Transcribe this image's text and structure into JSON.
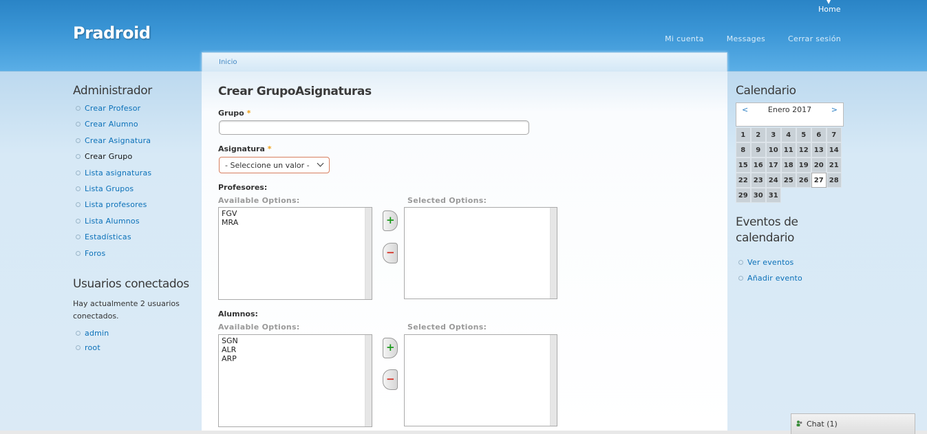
{
  "header": {
    "site_name": "Pradroid",
    "home": "Home",
    "secondary_nav": [
      "Mi cuenta",
      "Messages",
      "Cerrar sesión"
    ]
  },
  "breadcrumb": "Inicio",
  "sidebar_left": {
    "admin_title": "Administrador",
    "admin_menu": [
      {
        "label": "Crear Profesor",
        "active": false
      },
      {
        "label": "Crear Alumno",
        "active": false
      },
      {
        "label": "Crear Asignatura",
        "active": false
      },
      {
        "label": "Crear Grupo",
        "active": true
      },
      {
        "label": "Lista asignaturas",
        "active": false
      },
      {
        "label": "Lista Grupos",
        "active": false
      },
      {
        "label": "Lista profesores",
        "active": false
      },
      {
        "label": "Lista Alumnos",
        "active": false
      },
      {
        "label": "Estadísticas",
        "active": false
      },
      {
        "label": "Foros",
        "active": false
      }
    ],
    "users_title": "Usuarios conectados",
    "users_text": "Hay actualmente 2 usuarios conectados.",
    "users": [
      "admin",
      "root"
    ]
  },
  "main": {
    "title": "Crear GrupoAsignaturas",
    "grupo_label": "Grupo",
    "grupo_value": "",
    "asignatura_label": "Asignatura",
    "required_mark": "*",
    "asignatura_selected": "- Seleccione un valor -",
    "profesores": {
      "label": "Profesores:",
      "available_label": "Available Options:",
      "selected_label": "Selected Options:",
      "available": [
        "FGV",
        "MRA"
      ],
      "selected": []
    },
    "alumnos": {
      "label": "Alumnos:",
      "available_label": "Available Options:",
      "selected_label": "Selected Options:",
      "available": [
        "SGN",
        "ALR",
        "ARP"
      ],
      "selected": []
    },
    "add_symbol": "+",
    "remove_symbol": "−"
  },
  "sidebar_right": {
    "calendar_title": "Calendario",
    "calendar": {
      "prev": "<",
      "next": ">",
      "month": "Enero 2017",
      "days": [
        "1",
        "2",
        "3",
        "4",
        "5",
        "6",
        "7",
        "8",
        "9",
        "10",
        "11",
        "12",
        "13",
        "14",
        "15",
        "16",
        "17",
        "18",
        "19",
        "20",
        "21",
        "22",
        "23",
        "24",
        "25",
        "26",
        "27",
        "28",
        "29",
        "30",
        "31"
      ],
      "today": "27"
    },
    "events_title": "Eventos de calendario",
    "events_menu": [
      "Ver eventos",
      "Añadir evento"
    ]
  },
  "chat": {
    "label": "Chat (1)"
  }
}
